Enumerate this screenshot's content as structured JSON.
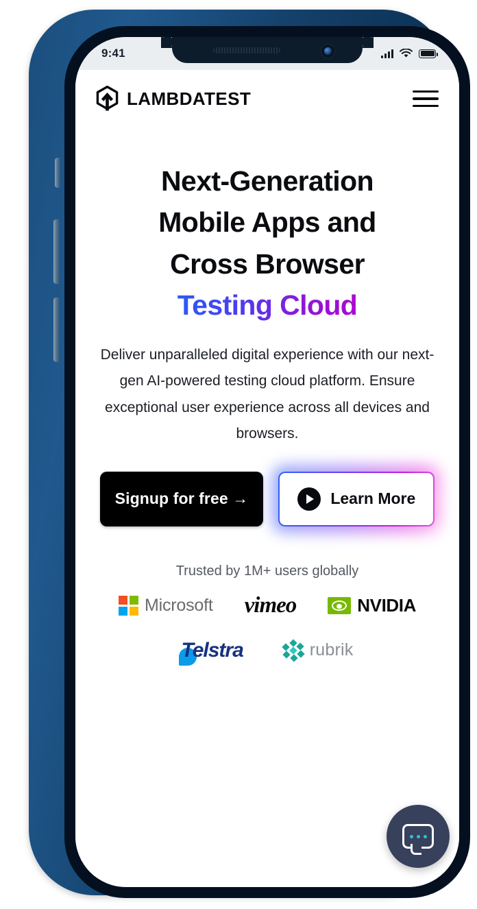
{
  "status_bar": {
    "time": "9:41",
    "signal_icon": "cellular-bars-icon",
    "wifi_icon": "wifi-icon",
    "battery_icon": "battery-full-icon"
  },
  "navbar": {
    "logo_icon": "lambdatest-hexagon-arrow-icon",
    "brand": "LAMBDATEST",
    "menu_icon": "hamburger-menu-icon"
  },
  "hero": {
    "headline_line1": "Next-Generation",
    "headline_line2": "Mobile Apps and",
    "headline_line3": "Cross Browser",
    "headline_highlight": "Testing Cloud",
    "highlight_gradient_from": "#2B5BF5",
    "highlight_gradient_to": "#AC07CF",
    "subtext": "Deliver unparalleled digital experience with our next-gen AI-powered testing cloud platform. Ensure exceptional user experience across all devices and browsers.",
    "primary_cta": "Signup for free →",
    "secondary_cta": "Learn More",
    "secondary_cta_icon": "play-button-icon"
  },
  "social_proof": {
    "caption": "Trusted by 1M+ users globally",
    "logos_row1": [
      {
        "name": "Microsoft",
        "icon": "microsoft-logo-icon"
      },
      {
        "name": "vimeo",
        "icon": "vimeo-logo-icon"
      },
      {
        "name": "NVIDIA",
        "icon": "nvidia-logo-icon"
      }
    ],
    "logos_row2": [
      {
        "name": "Telstra",
        "icon": "telstra-logo-icon"
      },
      {
        "name": "rubrik",
        "icon": "rubrik-logo-icon"
      }
    ],
    "colors": {
      "microsoft_red": "#F25022",
      "microsoft_green": "#7FBA00",
      "microsoft_blue": "#00A4EF",
      "microsoft_yellow": "#FFB900",
      "nvidia_green": "#76B900",
      "telstra_blue": "#16317F",
      "telstra_accent": "#0D9AE8",
      "rubrik_teal": "#19A79A"
    }
  },
  "chat_widget": {
    "icon": "chat-bubble-icon",
    "background": "#37415C",
    "dot_color": "#28C4D6"
  },
  "device": {
    "frame_color": "#1B4E7D",
    "bezel_color": "#04101F",
    "buttons": [
      "mute-switch",
      "volume-up",
      "volume-down",
      "power-button"
    ]
  }
}
